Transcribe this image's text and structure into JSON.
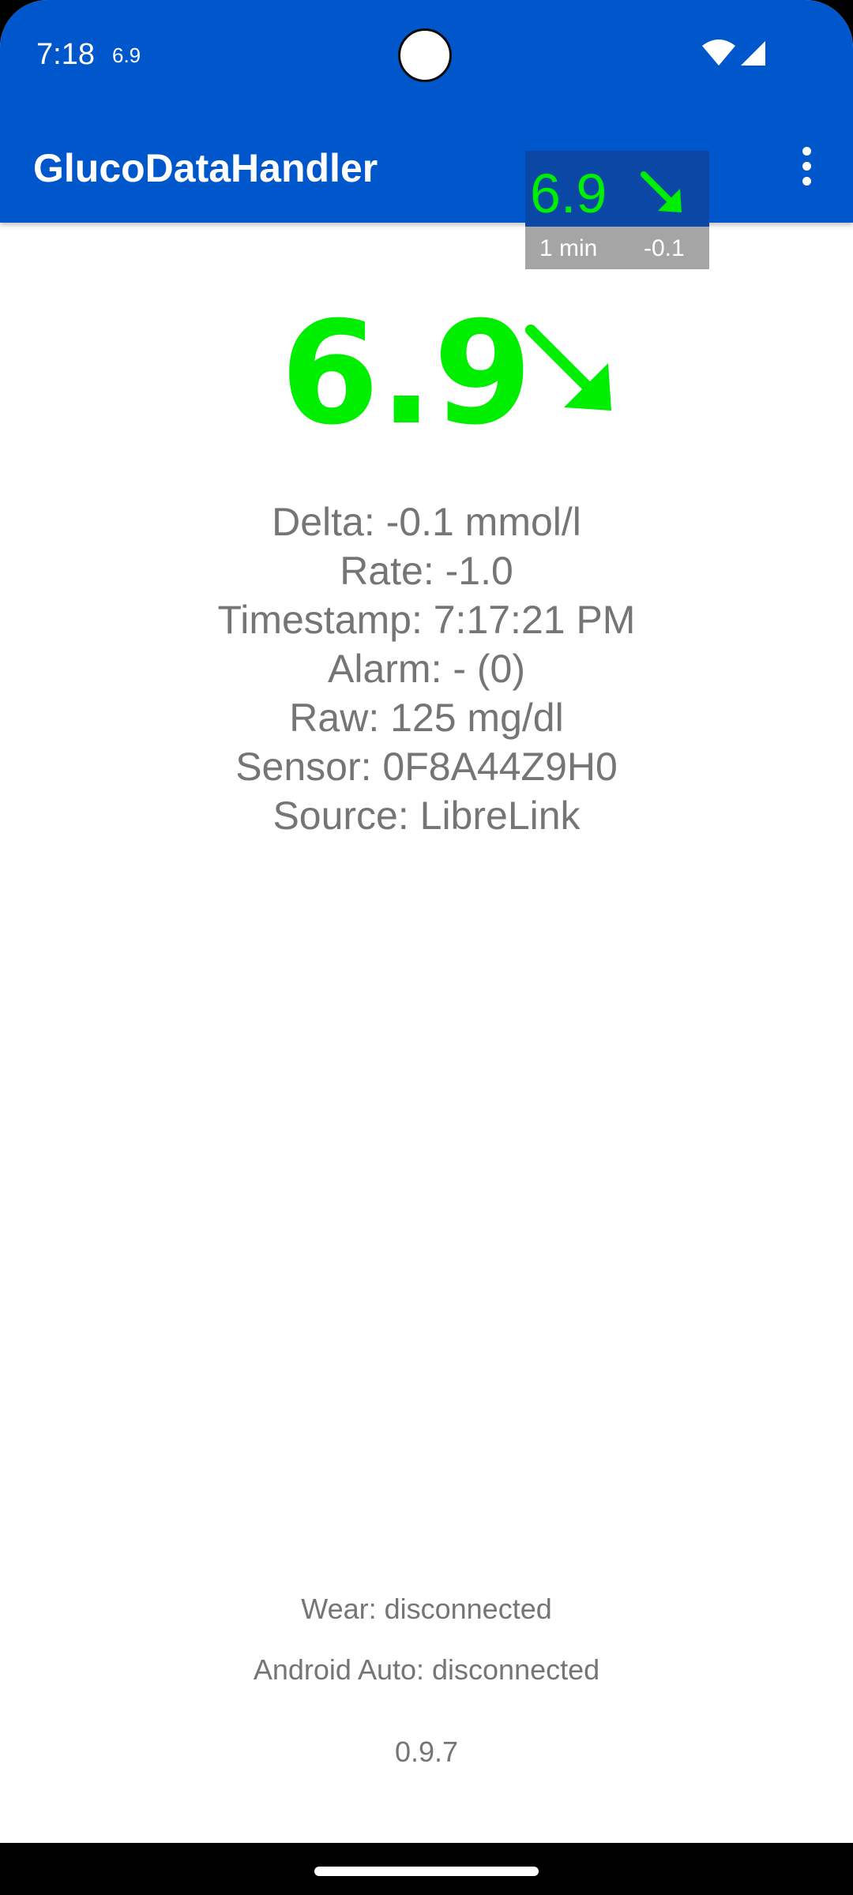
{
  "status_bar": {
    "time": "7:18",
    "glucose_notification": "6.9",
    "icons": [
      "wifi-icon",
      "cell-signal-icon"
    ]
  },
  "app_bar": {
    "title": "GlucoDataHandler",
    "menu_icon": "overflow-menu-icon"
  },
  "widget": {
    "value": "6.9",
    "arrow_icon": "arrow-down-right-icon",
    "elapsed": "1 min",
    "delta": "-0.1"
  },
  "glucose": {
    "value": "6.9",
    "trend_icon": "arrow-down-right-icon"
  },
  "details": {
    "delta": "Delta: -0.1 mmol/l",
    "rate": "Rate: -1.0",
    "timestamp": "Timestamp: 7:17:21 PM",
    "alarm": "Alarm: - (0)",
    "raw": "Raw: 125 mg/dl",
    "sensor": "Sensor: 0F8A44Z9H0",
    "source": "Source: LibreLink"
  },
  "footer": {
    "wear": "Wear: disconnected",
    "android_auto": "Android Auto: disconnected",
    "version": "0.9.7"
  },
  "colors": {
    "primary": "#0057CC",
    "glucose_ok": "#00EE00",
    "text_secondary": "#757575"
  }
}
